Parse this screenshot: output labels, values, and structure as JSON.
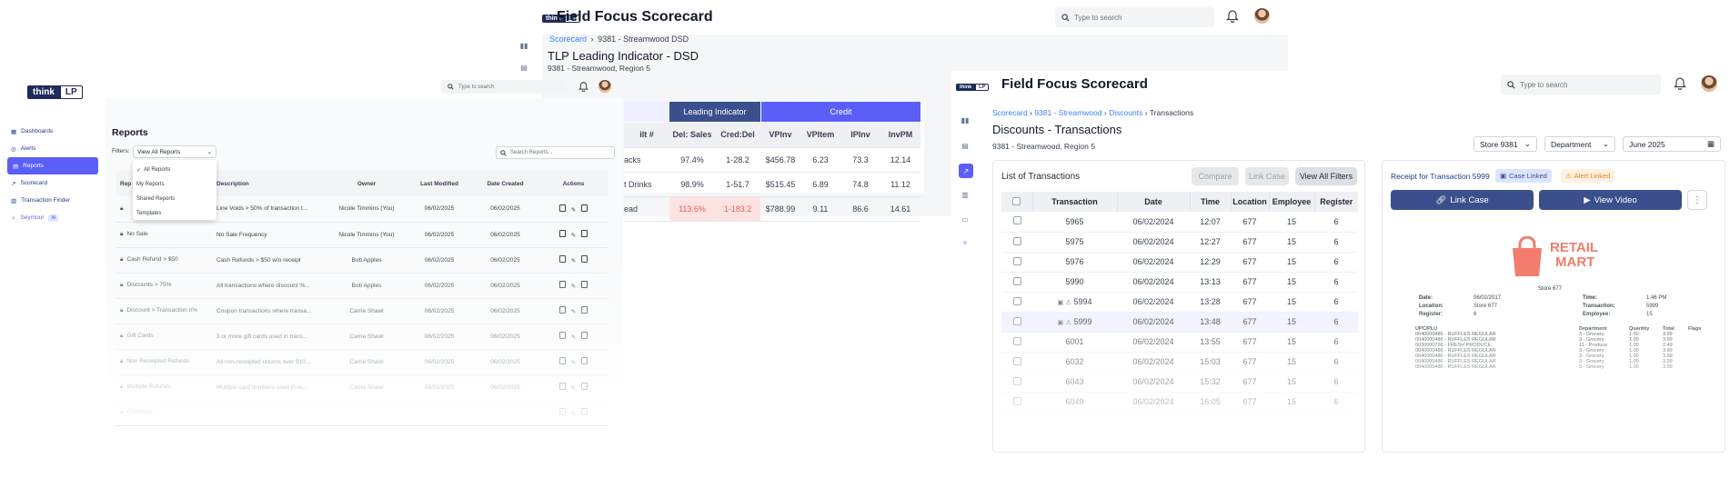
{
  "logo": {
    "think": "think",
    "lp": "LP"
  },
  "window1": {
    "search_placeholder": "Type to search",
    "sidebar": [
      {
        "label": "Dashboards",
        "icon": "dashboard-icon"
      },
      {
        "label": "Alerts",
        "icon": "alert-icon"
      },
      {
        "label": "Reports",
        "icon": "report-icon",
        "active": true
      },
      {
        "label": "Scorecard",
        "icon": "scorecard-icon"
      },
      {
        "label": "Transaction Finder",
        "icon": "transaction-icon"
      },
      {
        "label": "Seymour",
        "icon": "sparkle-icon",
        "badge": "AI"
      }
    ],
    "title": "Reports",
    "filters_label": "Filters:",
    "filter_value": "View All Reports",
    "filter_options": [
      "All Reports",
      "My Reports",
      "Shared Reports",
      "Templates"
    ],
    "search_reports_placeholder": "Search Reports...",
    "columns": [
      "Rep",
      "Description",
      "Owner",
      "Last Modified",
      "Date Created",
      "Actions"
    ],
    "rows": [
      {
        "name": "",
        "desc": "Line Voids > 50% of transaction t...",
        "owner": "Nicole Timmins (You)",
        "mod": "06/02/2025",
        "created": "06/02/2025"
      },
      {
        "name": "No Sale",
        "desc": "No Sale Frequency",
        "owner": "Nicole Timmins (You)",
        "mod": "06/02/2025",
        "created": "06/02/2025"
      },
      {
        "name": "Cash Refund > $50",
        "desc": "Cash Refunds > $50 w/o receipt",
        "owner": "Bob Apples",
        "mod": "06/02/2025",
        "created": "06/02/2025"
      },
      {
        "name": "Discounts > 75%",
        "desc": "All transactions where discount %...",
        "owner": "Bob Apples",
        "mod": "06/02/2025",
        "created": "06/02/2025"
      },
      {
        "name": "Discount > Transaction n%",
        "desc": "Coupon transactions where transa...",
        "owner": "Carrie Shawl",
        "mod": "06/02/2025",
        "created": "06/02/2025"
      },
      {
        "name": "Gift Cards",
        "desc": "3 or more gift cards used in trans...",
        "owner": "Carrie Shawl",
        "mod": "06/02/2025",
        "created": "06/02/2025"
      },
      {
        "name": "Non Receipted Refunds",
        "desc": "All non-receipted returns over $10...",
        "owner": "Carrie Shawl",
        "mod": "06/02/2025",
        "created": "06/02/2025"
      },
      {
        "name": "Multiple Refunds",
        "desc": "Multiple card numbers used in re...",
        "owner": "Carrie Shawl",
        "mod": "06/02/2025",
        "created": "06/02/2025"
      },
      {
        "name": "Overrides",
        "desc": "",
        "owner": "",
        "mod": "",
        "created": ""
      }
    ]
  },
  "window2": {
    "app_title": "Field Focus Scorecard",
    "search_placeholder": "Type to search",
    "breadcrumb_link": "Scorecard",
    "breadcrumb_current": "9381 - Streamwood DSD",
    "page_title": "TLP Leading Indicator - DSD",
    "subtitle": "9381 - Streamwood, Region 5",
    "group_headers": [
      "Leading Indicator",
      "Credit"
    ],
    "columns": [
      "ilt #",
      "Del: Sales",
      "Cred:Del",
      "VPInv",
      "VPItem",
      "IPInv",
      "InvPM"
    ],
    "rows": [
      [
        "acks",
        "97.4%",
        "1-28.2",
        "$456.78",
        "6.23",
        "73.3",
        "12.14"
      ],
      [
        "t Drinks",
        "98.9%",
        "1-51.7",
        "$515.45",
        "6.89",
        "74.8",
        "11.12"
      ],
      [
        "ead",
        "113.6%",
        "1-183.2",
        "$788.99",
        "9.11",
        "86.6",
        "14.61"
      ]
    ],
    "highlight_color": "#fde2e2"
  },
  "window3": {
    "app_title": "Field Focus Scorecard",
    "search_placeholder": "Type to search",
    "breadcrumb": [
      "Scorecard",
      "9381 - Streamwood",
      "Discounts",
      "Transactions"
    ],
    "page_title": "Discounts - Transactions",
    "subtitle": "9381 - Streamwood, Region 5",
    "store_select": "Store 9381",
    "department_select": "Department",
    "date_select": "June 2025",
    "list_title": "List of Transactions",
    "compare_label": "Compare",
    "link_case_label": "Link Case",
    "view_filters_label": "View All Filters",
    "columns": [
      "Transaction",
      "Date",
      "Time",
      "Location",
      "Employee",
      "Register"
    ],
    "rows": [
      [
        "5965",
        "06/02/2024",
        "12:07",
        "677",
        "15",
        "6"
      ],
      [
        "5975",
        "06/02/2024",
        "12:27",
        "677",
        "15",
        "6"
      ],
      [
        "5976",
        "06/02/2024",
        "12:29",
        "677",
        "15",
        "6"
      ],
      [
        "5990",
        "06/02/2024",
        "13:13",
        "677",
        "15",
        "6"
      ],
      [
        "5994",
        "06/02/2024",
        "13:28",
        "677",
        "15",
        "6"
      ],
      [
        "5999",
        "06/02/2024",
        "13:48",
        "677",
        "15",
        "6"
      ],
      [
        "6001",
        "06/02/2024",
        "13:55",
        "677",
        "15",
        "6"
      ],
      [
        "6032",
        "06/02/2024",
        "15:03",
        "677",
        "15",
        "6"
      ],
      [
        "6043",
        "06/02/2024",
        "15:32",
        "677",
        "15",
        "6"
      ],
      [
        "6049",
        "06/02/2024",
        "16:05",
        "677",
        "15",
        "6"
      ]
    ],
    "receipt_title": "Receipt for Transaction 5999",
    "case_linked": "Case Linked",
    "alert_linked": "Alert Linked",
    "receipt_link_case": "Link Case",
    "view_video": "View Video",
    "brand_retail": "RETAIL",
    "brand_mart": "MART",
    "store_line": "Store 677",
    "receipt_left": [
      [
        "Date:",
        "06/02/2017"
      ],
      [
        "Location:",
        "Store 677"
      ],
      [
        "Register:",
        "6"
      ]
    ],
    "receipt_right": [
      [
        "Time:",
        "1:46 PM"
      ],
      [
        "Transaction:",
        "5999"
      ],
      [
        "Employee:",
        "15"
      ]
    ],
    "item_columns": [
      "UPC/PLU",
      "Department",
      "Quantity",
      "Total",
      "Flags"
    ],
    "items": [
      [
        "0040000486 - RUFFLES REGULAR",
        "3 - Grocery",
        "1.00",
        "3.99"
      ],
      [
        "0040000486 - RUFFLES REGULAR",
        "3 - Grocery",
        "1.00",
        "3.99"
      ],
      [
        "0030000766 - FRESH PRODUCE",
        "11 - Produce",
        "1.00",
        "2.49"
      ],
      [
        "0040000486 - RUFFLES REGULAR",
        "3 - Grocery",
        "1.00",
        "3.99"
      ],
      [
        "0040000486 - RUFFLES REGULAR",
        "3 - Grocery",
        "1.00",
        "3.99"
      ],
      [
        "0040000486 - RUFFLES REGULAR",
        "3 - Grocery",
        "1.00",
        "3.99"
      ],
      [
        "0040000486 - RUFFLES REGULAR",
        "3 - Grocery",
        "1.00",
        "3.99"
      ]
    ],
    "accent": "#5b5ff7",
    "brand_color": "#f27c6d"
  }
}
